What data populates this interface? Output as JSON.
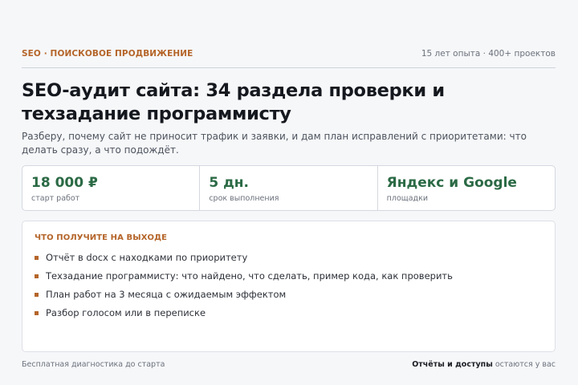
{
  "header": {
    "kicker": "SEO · ПОИСКОВОЕ ПРОДВИЖЕНИЕ",
    "meta": "15 лет опыта · 400+ проектов"
  },
  "title": "SEO-аудит сайта: 34 раздела проверки и техзадание программисту",
  "subtitle": "Разберу, почему сайт не приносит трафик и заявки, и дам план исправлений с приоритетами: что делать сразу, а что подождёт.",
  "stats": [
    {
      "value": "18 000 ₽",
      "label": "старт работ"
    },
    {
      "value": "5 дн.",
      "label": "срок выполнения"
    },
    {
      "value": "Яндекс и Google",
      "label": "площадки"
    }
  ],
  "deliverables": {
    "title": "ЧТО ПОЛУЧИТЕ НА ВЫХОДЕ",
    "items": [
      "Отчёт в docx с находками по приоритету",
      "Техзадание программисту: что найдено, что сделать, пример кода, как проверить",
      "План работ на 3 месяца с ожидаемым эффектом",
      "Разбор голосом или в переписке"
    ]
  },
  "footer": {
    "left": "Бесплатная диагностика до старта",
    "right_strong": "Отчёты и доступы",
    "right_rest": " остаются у вас"
  },
  "colors": {
    "accent": "#b5652a",
    "value_green": "#2b6a45"
  }
}
